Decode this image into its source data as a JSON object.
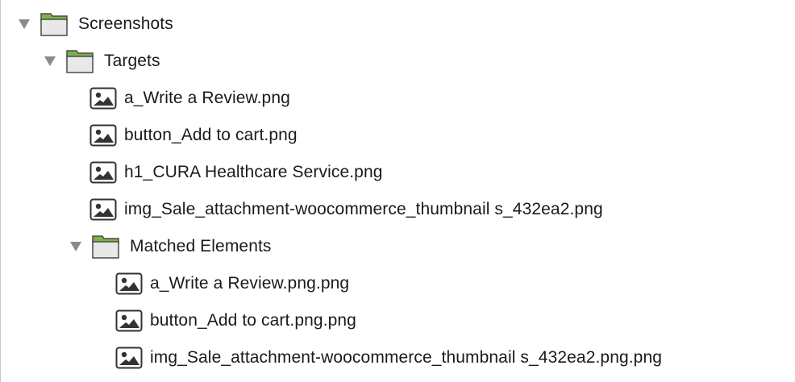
{
  "tree": {
    "root": {
      "label": "Screenshots",
      "icon": "folder-icon",
      "expanded": true
    },
    "targets": {
      "label": "Targets",
      "icon": "folder-icon",
      "expanded": true,
      "files": [
        {
          "label": "a_Write a Review.png",
          "icon": "image-file-icon"
        },
        {
          "label": "button_Add to cart.png",
          "icon": "image-file-icon"
        },
        {
          "label": "h1_CURA Healthcare Service.png",
          "icon": "image-file-icon"
        },
        {
          "label": "img_Sale_attachment-woocommerce_thumbnail s_432ea2.png",
          "icon": "image-file-icon"
        }
      ]
    },
    "matched": {
      "label": "Matched Elements",
      "icon": "folder-icon",
      "expanded": true,
      "files": [
        {
          "label": "a_Write a Review.png.png",
          "icon": "image-file-icon"
        },
        {
          "label": "button_Add to cart.png.png",
          "icon": "image-file-icon"
        },
        {
          "label": "img_Sale_attachment-woocommerce_thumbnail s_432ea2.png.png",
          "icon": "image-file-icon"
        }
      ]
    }
  },
  "colors": {
    "folder_tab": "#7cb342",
    "folder_body": "#e8e8e8",
    "folder_outline": "#4a4a4a",
    "triangle": "#8a8a8a",
    "text": "#1a1a1a"
  }
}
